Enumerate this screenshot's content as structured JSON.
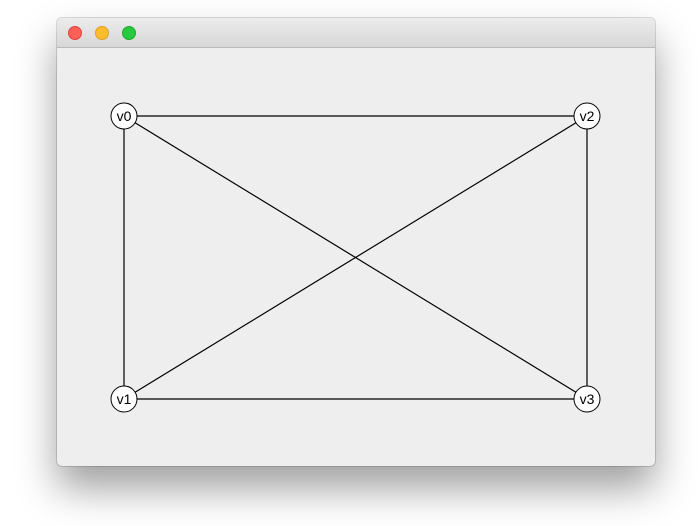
{
  "window": {
    "controls": [
      {
        "name": "close-button",
        "color": "#fe5f57"
      },
      {
        "name": "minimize-button",
        "color": "#febc2e"
      },
      {
        "name": "zoom-button",
        "color": "#28c840"
      }
    ]
  },
  "graph": {
    "vertices": [
      {
        "id": "v0",
        "label": "v0"
      },
      {
        "id": "v1",
        "label": "v1"
      },
      {
        "id": "v2",
        "label": "v2"
      },
      {
        "id": "v3",
        "label": "v3"
      }
    ],
    "edges": [
      [
        "v0",
        "v2"
      ],
      [
        "v0",
        "v1"
      ],
      [
        "v0",
        "v3"
      ],
      [
        "v1",
        "v2"
      ],
      [
        "v1",
        "v3"
      ],
      [
        "v2",
        "v3"
      ]
    ]
  }
}
